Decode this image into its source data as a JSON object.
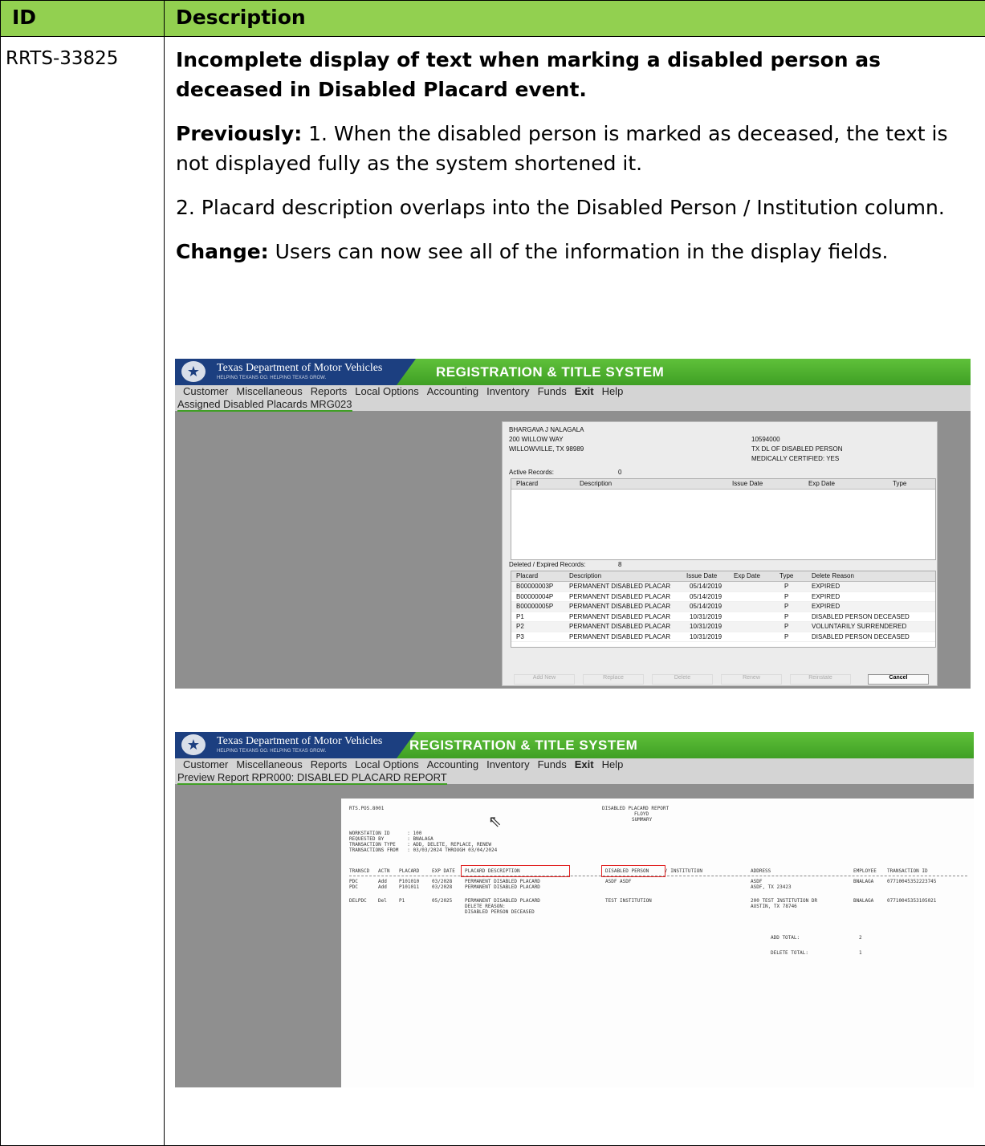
{
  "table": {
    "header_id": "ID",
    "header_description": "Description",
    "id": "RRTS-33825",
    "title": "Incomplete display of text when marking a disabled person as deceased in Disabled Placard event.",
    "previously_label": "Previously:",
    "previously_text": " 1. When the disabled person is marked as deceased, the text is not displayed fully as the system shortened it.",
    "point2": "2. Placard description overlaps into the Disabled Person / Institution column.",
    "change_label": "Change:",
    "change_text": " Users can now see all of the information in the display fields."
  },
  "app": {
    "org_name": "Texas Department of Motor Vehicles",
    "org_tagline": "HELPING TEXANS GO. HELPING TEXAS GROW.",
    "system_title": "REGISTRATION & TITLE SYSTEM",
    "menu": [
      "Customer",
      "Miscellaneous",
      "Reports",
      "Local Options",
      "Accounting",
      "Inventory",
      "Funds",
      "Exit",
      "Help"
    ]
  },
  "screen1": {
    "breadcrumb": "Assigned Disabled Placards MRG023",
    "name": "BHARGAVA J NALAGALA",
    "addr1": "200 WILLOW WAY",
    "addr2": "WILLOWVILLE, TX 98989",
    "dl_number": "10594000",
    "dl_type": "TX DL OF DISABLED PERSON",
    "medically": "MEDICALLY CERTIFIED: YES",
    "active_label": "Active Records:",
    "active_count": "0",
    "active_cols": [
      "Placard",
      "Description",
      "Issue Date",
      "Exp Date",
      "Type"
    ],
    "deleted_label": "Deleted / Expired Records:",
    "deleted_count": "8",
    "deleted_cols": [
      "Placard",
      "Description",
      "Issue Date",
      "Exp Date",
      "Type",
      "Delete Reason"
    ],
    "rows": [
      [
        "B00000003P",
        "PERMANENT DISABLED PLACAR",
        "05/14/2019",
        "",
        "P",
        "EXPIRED"
      ],
      [
        "B00000004P",
        "PERMANENT DISABLED PLACAR",
        "05/14/2019",
        "",
        "P",
        "EXPIRED"
      ],
      [
        "B00000005P",
        "PERMANENT DISABLED PLACAR",
        "05/14/2019",
        "",
        "P",
        "EXPIRED"
      ],
      [
        "P1",
        "PERMANENT DISABLED PLACAR",
        "10/31/2019",
        "",
        "P",
        "DISABLED PERSON DECEASED"
      ],
      [
        "P2",
        "PERMANENT DISABLED PLACAR",
        "10/31/2019",
        "",
        "P",
        "VOLUNTARILY SURRENDERED"
      ],
      [
        "P3",
        "PERMANENT DISABLED PLACAR",
        "10/31/2019",
        "",
        "P",
        "DISABLED PERSON DECEASED"
      ]
    ],
    "buttons": [
      "Add New",
      "Replace",
      "Delete",
      "Renew",
      "Reinstate",
      "Cancel"
    ]
  },
  "screen2": {
    "breadcrumb": "Preview Report RPR000: DISABLED PLACARD REPORT",
    "report_code": "RTS.POS.8001",
    "report_title": "DISABLED PLACARD REPORT",
    "county": "FLOYD",
    "summary": "SUMMARY",
    "meta": [
      "WORKSTATION ID      : 100",
      "REQUESTED BY        : BNALAGA",
      "TRANSACTION TYPE    : ADD, DELETE, REPLACE, RENEW",
      "TRANSACTIONS FROM   : 03/03/2024 THROUGH 03/04/2024"
    ],
    "col_transcd": "TRANSCD",
    "col_actn": "ACTN",
    "col_placard": "PLACARD",
    "col_expdate": "EXP DATE",
    "col_placard_desc": "PLACARD DESCRIPTION",
    "col_disabled_person": "DISABLED PERSON",
    "col_institution": "/ INSTITUTION",
    "col_address": "ADDRESS",
    "col_employee": "EMPLOYEE",
    "col_trans_id": "TRANSACTION ID",
    "r1": [
      "PDC",
      "Add",
      "P101010",
      "03/2028",
      "PERMANENT DISABLED PLACARD",
      "ASDF ASDF",
      "ASDF",
      "BNALAGA",
      "07710045352223745"
    ],
    "r2": [
      "PDC",
      "Add",
      "P101011",
      "03/2028",
      "PERMANENT DISABLED PLACARD",
      "",
      "ASDF, TX 23423",
      "",
      ""
    ],
    "r3": [
      "DELPDC",
      "Del",
      "P1",
      "05/2025",
      "PERMANENT DISABLED PLACARD",
      "TEST INSTITUTION",
      "200 TEST INSTITUTION DR",
      "BNALAGA",
      "07710045353105021"
    ],
    "r3_addr2": "AUSTIN, TX 78746",
    "r3_line2": "DELETE REASON:",
    "r3_line3": "DISABLED PERSON DECEASED",
    "add_total_label": "ADD TOTAL:",
    "add_total": "2",
    "delete_total_label": "DELETE TOTAL:",
    "delete_total": "1"
  }
}
